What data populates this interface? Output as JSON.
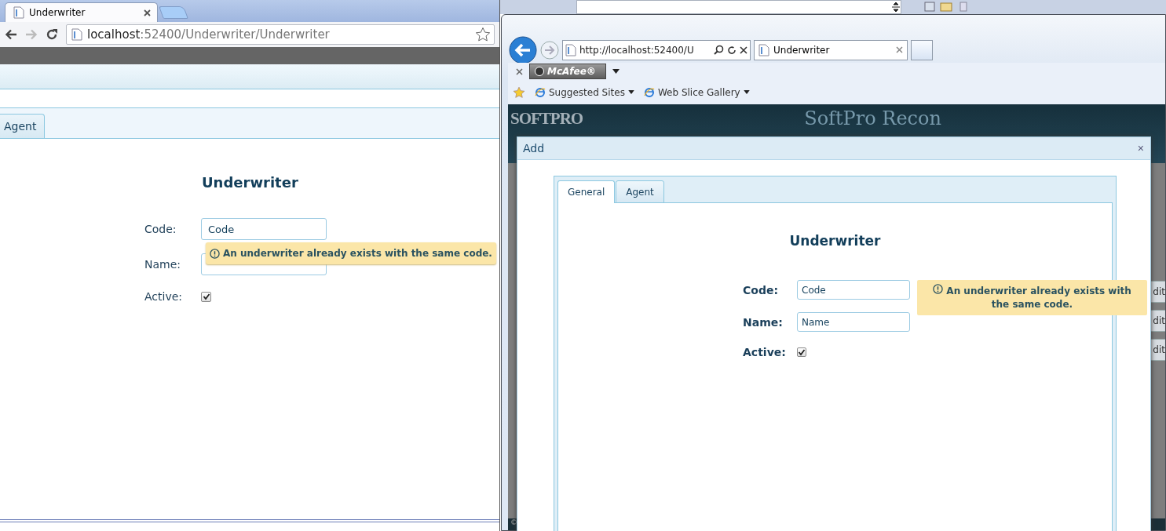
{
  "chrome": {
    "tab": {
      "title": "Underwriter"
    },
    "address": {
      "host": "localhost",
      "path": ":52400/Underwriter/Underwriter"
    },
    "page": {
      "tabs": [
        {
          "label": "Agent",
          "selected": false
        }
      ],
      "form": {
        "title": "Underwriter",
        "fields": [
          {
            "label": "Code:",
            "value": "Code"
          },
          {
            "label": "Name:"
          }
        ],
        "active": {
          "label": "Active:",
          "checked": true
        },
        "error": "An underwriter already exists with the same code."
      }
    }
  },
  "ie": {
    "address": "http://localhost:52400/U",
    "tab": {
      "title": "Underwriter"
    },
    "addon": "McAfee®",
    "favorites": [
      "Suggested Sites",
      "Web Slice Gallery"
    ],
    "site": {
      "logo": "SOFTPRO",
      "title": "SoftPro Recon",
      "footer": "©",
      "row_buttons": [
        "dit",
        "dit",
        "dit"
      ]
    },
    "dialog": {
      "title": "Add",
      "close": "×",
      "tabs": [
        {
          "label": "General",
          "selected": true
        },
        {
          "label": "Agent",
          "selected": false
        }
      ],
      "form": {
        "title": "Underwriter",
        "fields": [
          {
            "label": "Code:",
            "value": "Code"
          },
          {
            "label": "Name:",
            "value": "Name"
          }
        ],
        "active": {
          "label": "Active:",
          "checked": true
        },
        "error": "An underwriter already exists with the same code."
      }
    }
  }
}
